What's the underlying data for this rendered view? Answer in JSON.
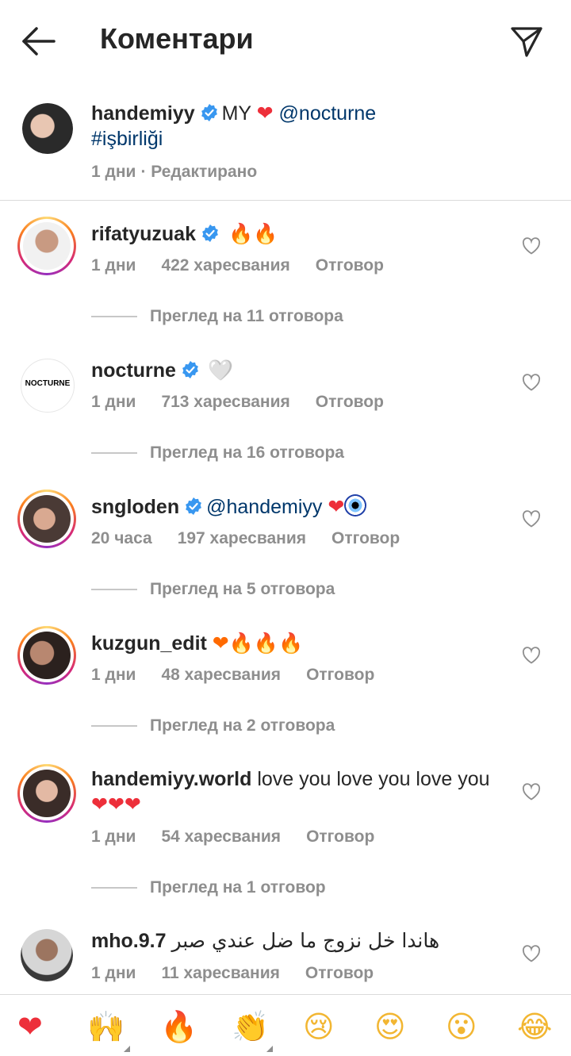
{
  "header": {
    "title": "Коментари",
    "back_icon": "arrow-left-icon",
    "send_icon": "paper-plane-icon"
  },
  "caption": {
    "username": "handemiyy",
    "text_pre": "MY",
    "heart": "❤",
    "mention": "@nocturne",
    "hashtag": "#işbirliği",
    "time": "1 дни",
    "edited": "· Редактирано"
  },
  "comments": [
    {
      "username": "rifatyuzuak",
      "verified": true,
      "text": "🔥🔥",
      "time": "1 дни",
      "likes": "422 харесвания",
      "reply": "Отговор",
      "view_replies": "Преглед на 11 отговора"
    },
    {
      "username": "nocturne",
      "verified": true,
      "text": "🤍",
      "time": "1 дни",
      "likes": "713 харесвания",
      "reply": "Отговор",
      "view_replies": "Преглед на 16 отговора",
      "avatar_text": "NOCTURNE"
    },
    {
      "username": "sngloden",
      "verified": true,
      "mention": "@handemiyy",
      "text": "❤",
      "time": "20 часа",
      "likes": "197 харесвания",
      "reply": "Отговор",
      "view_replies": "Преглед на 5 отговора"
    },
    {
      "username": "kuzgun_edit",
      "verified": false,
      "text": "❤🔥🔥🔥",
      "time": "1 дни",
      "likes": "48 харесвания",
      "reply": "Отговор",
      "view_replies": "Преглед на 2 отговора"
    },
    {
      "username": "handemiyy.world",
      "verified": false,
      "text": "love you love you love you",
      "text2": "❤❤❤",
      "time": "1 дни",
      "likes": "54 харесвания",
      "reply": "Отговор",
      "view_replies": "Преглед на 1 отговор"
    },
    {
      "username": "mho.9.7",
      "verified": false,
      "text": "هاندا خل نزوج ما ضل عندي صبر",
      "time": "1 дни",
      "likes": "11 харесвания",
      "reply": "Отговор"
    }
  ],
  "quick_reactions": [
    "❤",
    "🙌",
    "🔥",
    "👏",
    "😢",
    "😍",
    "😮",
    "😂"
  ],
  "colors": {
    "link": "#00376b",
    "meta": "#8e8e8e",
    "verified": "#3897f0",
    "heart": "#ed2f3a"
  }
}
